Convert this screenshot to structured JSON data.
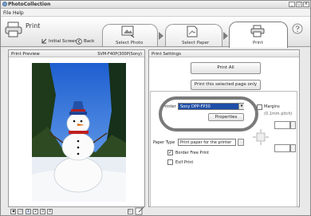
{
  "window": {
    "title": "PhotoCollection",
    "min": "_",
    "max": "□",
    "close": "×"
  },
  "menu": {
    "file": "File",
    "help": "Help"
  },
  "toolbar": {
    "mode_title": "Print",
    "initial_screen": "Initial Screen",
    "back": "Back",
    "steps": [
      {
        "label": "Select Photo"
      },
      {
        "label": "Select Paper"
      },
      {
        "label": "Print"
      }
    ]
  },
  "preview": {
    "title": "Print Preview",
    "paper": "SVM-F40P(300P(Sony)",
    "pages": [
      "1",
      "2",
      "3",
      "4"
    ]
  },
  "settings": {
    "title": "Print Settings",
    "print_all": "Print All",
    "print_selected": "Print this selected page only",
    "printer_label": "Printer",
    "printer_value": "Sony DPP-FP30",
    "properties": "Properties",
    "paper_type_label": "Paper Type",
    "paper_type_value": "Print paper for the printer",
    "border_free": "Border Free Print",
    "border_free_checked": true,
    "exif": "Exif Print",
    "exif_checked": false,
    "margins_label": "Margins",
    "margins_unit": "(0.1mm pitch)"
  },
  "colors": {
    "accent": "#1f4fa8",
    "highlight_oval": "#7a7a7a"
  }
}
